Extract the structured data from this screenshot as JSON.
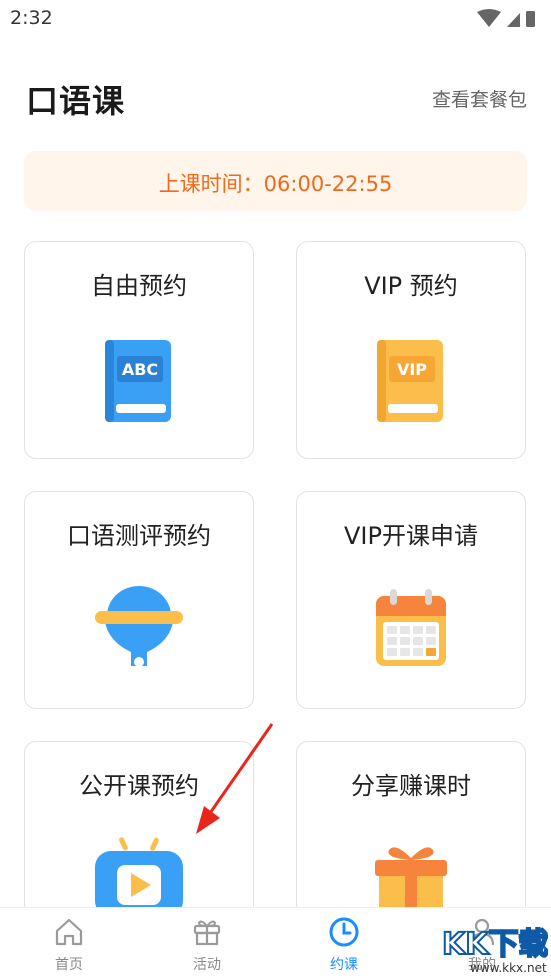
{
  "status_bar": {
    "time": "2:32"
  },
  "header": {
    "title": "口语课",
    "link": "查看套餐包"
  },
  "notice": {
    "text": "上课时间：06:00-22:55"
  },
  "cards": [
    {
      "title": "自由预约",
      "icon": "abc-book-icon"
    },
    {
      "title": "VIP 预约",
      "icon": "vip-book-icon"
    },
    {
      "title": "口语测评预约",
      "icon": "funnel-icon"
    },
    {
      "title": "VIP开课申请",
      "icon": "calendar-icon"
    },
    {
      "title": "公开课预约",
      "icon": "tv-play-icon"
    },
    {
      "title": "分享赚课时",
      "icon": "gift-icon"
    }
  ],
  "bottom_nav": [
    {
      "label": "首页",
      "icon": "home-icon",
      "active": false
    },
    {
      "label": "活动",
      "icon": "gift-icon",
      "active": false
    },
    {
      "label": "约课",
      "icon": "clock-icon",
      "active": true
    },
    {
      "label": "我的",
      "icon": "user-icon",
      "active": false
    }
  ],
  "watermark": {
    "text": "KK下载",
    "url": "www.kkx.net"
  },
  "colors": {
    "accent": "#1a8cff",
    "notice_text": "#f06a1a",
    "notice_bg": "#fff5ea"
  }
}
